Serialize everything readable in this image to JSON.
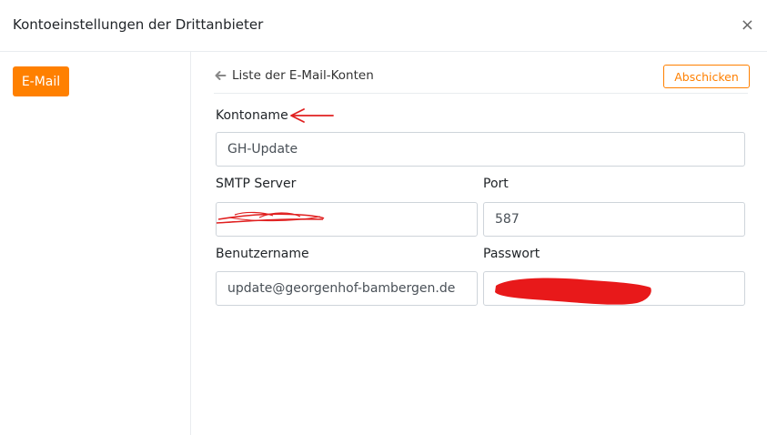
{
  "dialog": {
    "title": "Kontoeinstellungen der Drittanbieter",
    "close_symbol": "×"
  },
  "sidebar": {
    "items": [
      {
        "label": "E-Mail",
        "active": true
      }
    ]
  },
  "topbar": {
    "back_label": "Liste der E-Mail-Konten",
    "submit_label": "Abschicken"
  },
  "form": {
    "account_name": {
      "label": "Kontoname",
      "value": "GH-Update"
    },
    "smtp_server": {
      "label": "SMTP Server",
      "value": ""
    },
    "port": {
      "label": "Port",
      "value": "587"
    },
    "username": {
      "label": "Benutzername",
      "value": "update@georgenhof-bambergen.de"
    },
    "password": {
      "label": "Passwort",
      "value": ""
    }
  },
  "colors": {
    "accent": "#ff8000",
    "annotation": "#e02020"
  }
}
